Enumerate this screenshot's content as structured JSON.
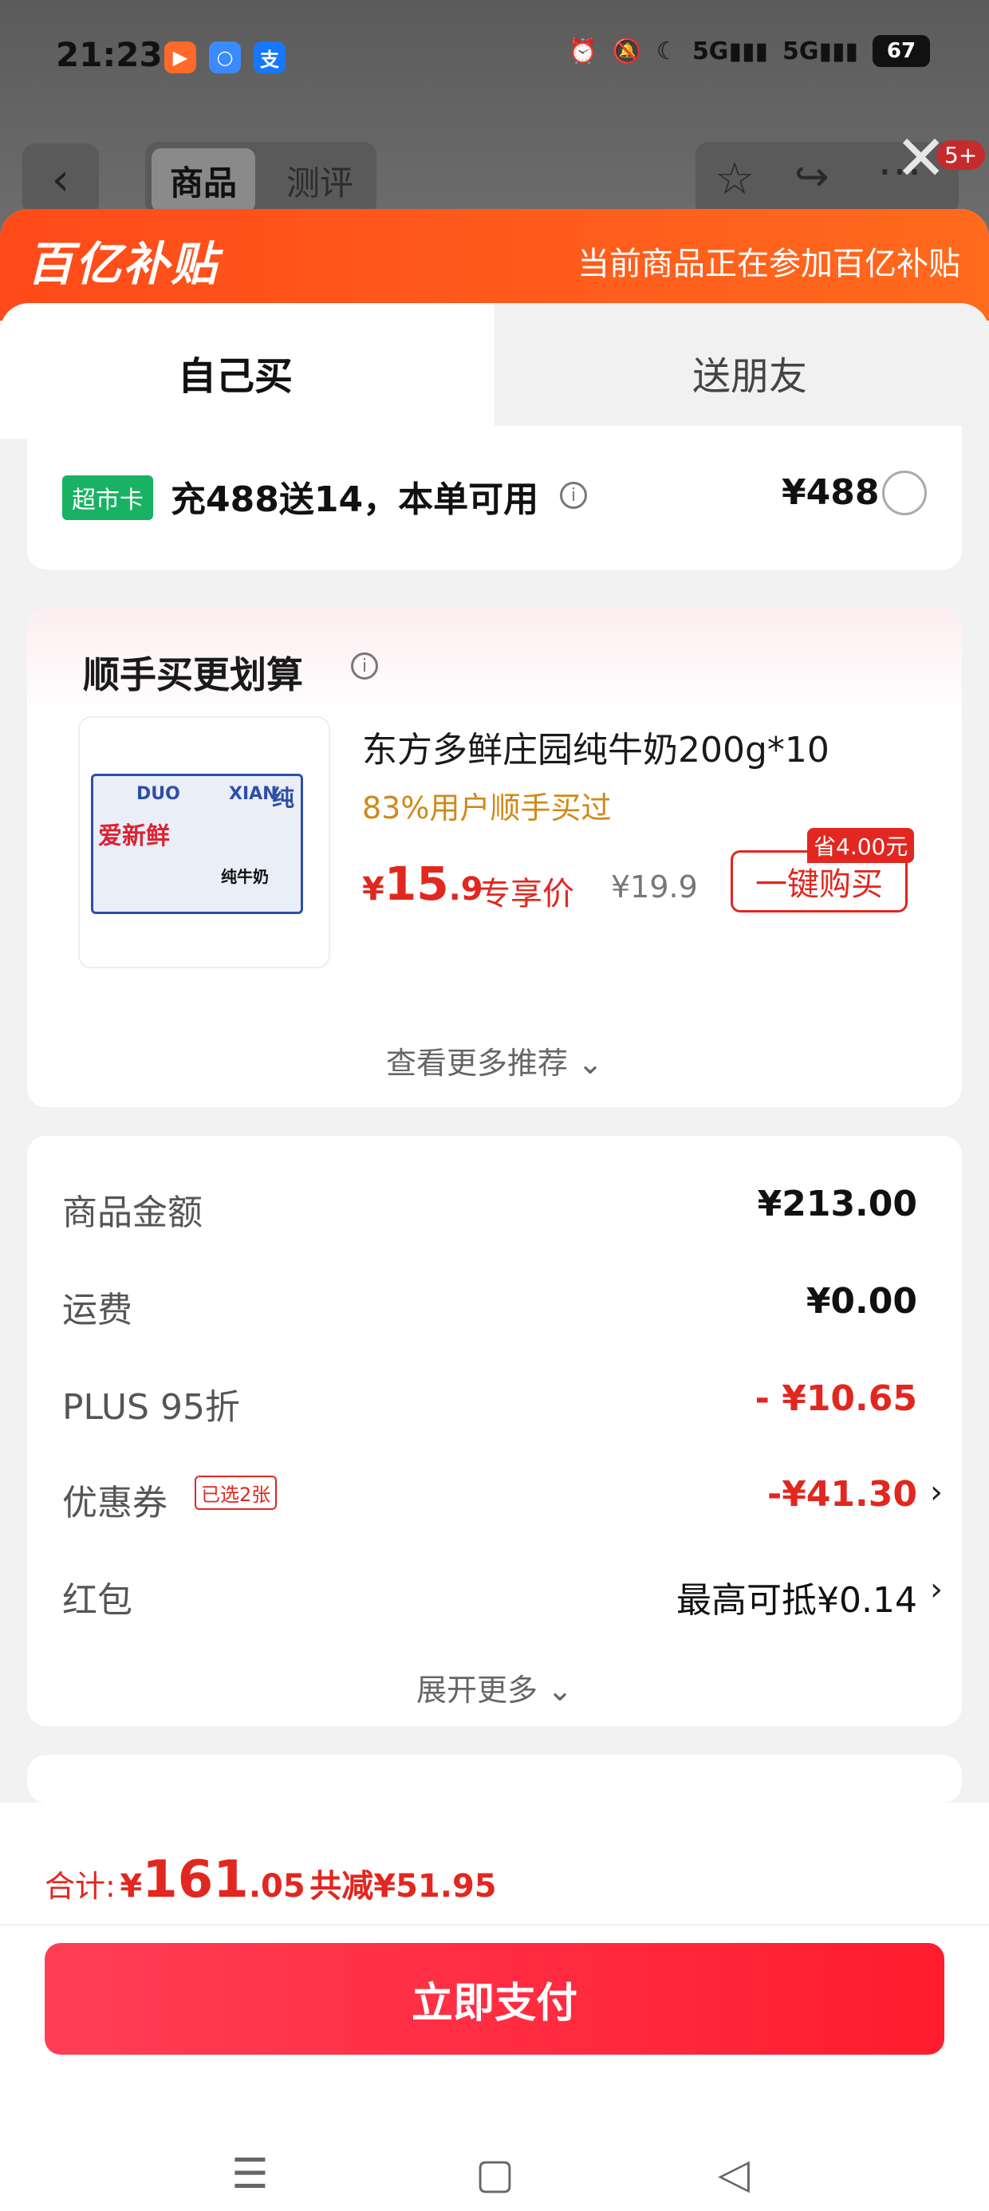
{
  "status_bar": {
    "time": "21:23",
    "signal_1": "5G",
    "signal_2": "5G",
    "battery": "67",
    "notification_count": "5+"
  },
  "background_page": {
    "segment_active": "商品",
    "segment_other": "测评"
  },
  "banner": {
    "logo": "百亿补贴",
    "message": "当前商品正在参加百亿补贴"
  },
  "tabs": {
    "buy_self": "自己买",
    "gift_friend": "送朋友"
  },
  "supermarket_card": {
    "tag": "超市卡",
    "text": "充488送14，本单可用",
    "price": "¥488"
  },
  "recommendation": {
    "title": "顺手买更划算",
    "product_name": "东方多鲜庄园纯牛奶200g*10",
    "user_stat": "83%用户顺手买过",
    "price_currency": "¥",
    "price_int": "15",
    "price_dec": ".9",
    "exclusive_label": "专享价",
    "original_price": "¥19.9",
    "save_tag": "省4.00元",
    "buy_button": "一键购买",
    "more": "查看更多推荐",
    "image_text": {
      "brand_a": "DUO",
      "brand_b": "XIAN",
      "side_a": "爱新鲜",
      "side_b": "纯",
      "pack": "纯牛奶"
    }
  },
  "price_details": {
    "rows": [
      {
        "label": "商品金额",
        "value": "¥213.00"
      },
      {
        "label": "运费",
        "value": "¥0.00"
      },
      {
        "label": "PLUS 95折",
        "value": "- ¥10.65"
      },
      {
        "label": "优惠券",
        "value": "-¥41.30",
        "tag": "已选2张"
      },
      {
        "label": "红包",
        "value": "最高可抵¥0.14"
      }
    ],
    "expand_more": "展开更多"
  },
  "bottom_bar": {
    "total_label": "合计:",
    "total_currency": "¥",
    "total_int": "161",
    "total_dec": ".05",
    "total_saved": "共减¥51.95",
    "pay_button": "立即支付"
  },
  "colors": {
    "accent_red": "#e1271f",
    "banner_orange": "#ff4a1a",
    "tag_green": "#19b264",
    "highlight_orange": "#d08918"
  }
}
